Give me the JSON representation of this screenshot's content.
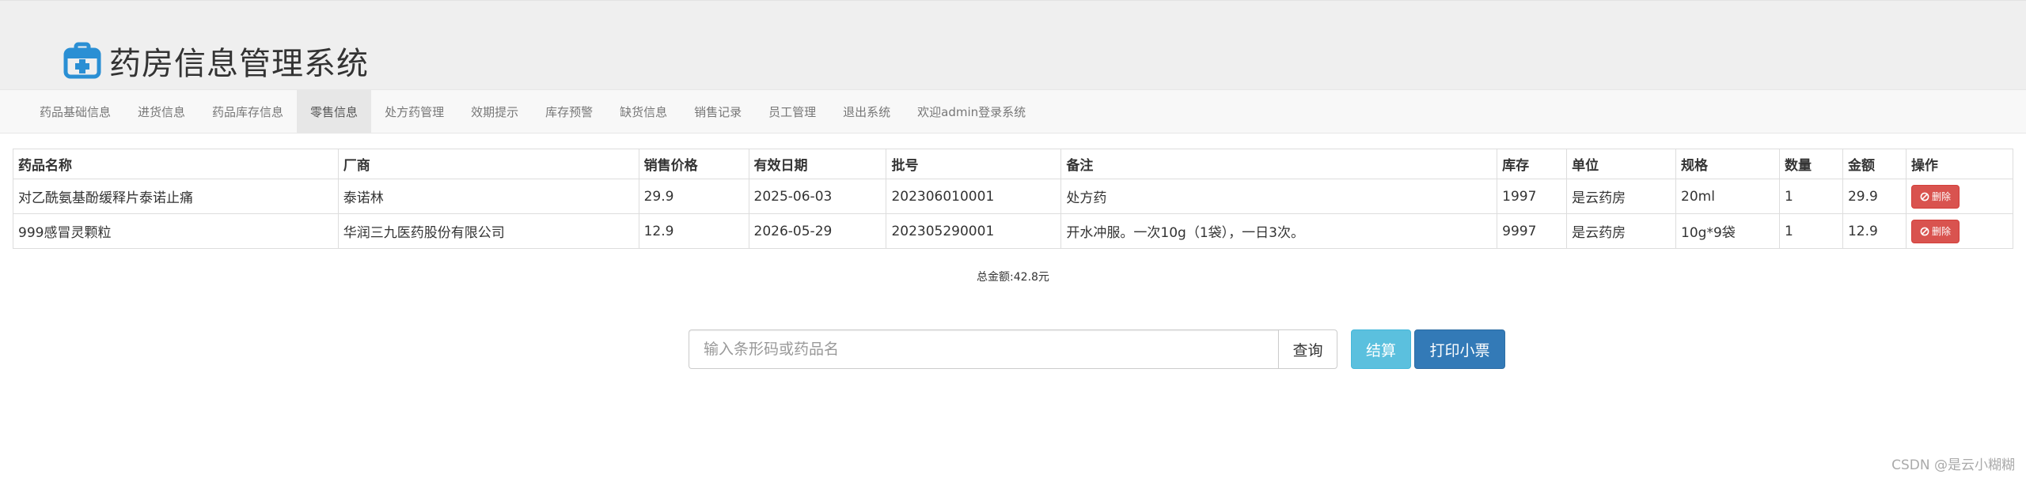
{
  "app": {
    "title": "药房信息管理系统"
  },
  "nav": {
    "items": [
      {
        "label": "药品基础信息"
      },
      {
        "label": "进货信息"
      },
      {
        "label": "药品库存信息"
      },
      {
        "label": "零售信息"
      },
      {
        "label": "处方药管理"
      },
      {
        "label": "效期提示"
      },
      {
        "label": "库存预警"
      },
      {
        "label": "缺货信息"
      },
      {
        "label": "销售记录"
      },
      {
        "label": "员工管理"
      },
      {
        "label": "退出系统"
      },
      {
        "label": "欢迎admin登录系统"
      }
    ],
    "active_index": 3
  },
  "table": {
    "headers": [
      "药品名称",
      "厂商",
      "销售价格",
      "有效日期",
      "批号",
      "备注",
      "库存",
      "单位",
      "规格",
      "数量",
      "金额",
      "操作"
    ],
    "rows": [
      {
        "name": "对乙酰氨基酚缓释片泰诺止痛",
        "maker": "泰诺林",
        "price": "29.9",
        "expiry": "2025-06-03",
        "batch": "202306010001",
        "note": "处方药",
        "stock": "1997",
        "unit": "是云药房",
        "spec": "20ml",
        "qty": "1",
        "amount": "29.9",
        "action": "删除"
      },
      {
        "name": "999感冒灵颗粒",
        "maker": "华润三九医药股份有限公司",
        "price": "12.9",
        "expiry": "2026-05-29",
        "batch": "202305290001",
        "note": "开水冲服。一次10g（1袋），一日3次。",
        "stock": "9997",
        "unit": "是云药房",
        "spec": "10g*9袋",
        "qty": "1",
        "amount": "12.9",
        "action": "删除"
      }
    ]
  },
  "summary": {
    "total_label": "总金额:42.8元"
  },
  "search": {
    "placeholder": "输入条形码或药品名",
    "query_label": "查询",
    "settle_label": "结算",
    "print_label": "打印小票"
  },
  "watermark": "CSDN @是云小糊糊",
  "colors": {
    "brand_blue": "#2a8fd4",
    "danger": "#d9534f",
    "info": "#5bc0de",
    "primary": "#337ab7"
  }
}
